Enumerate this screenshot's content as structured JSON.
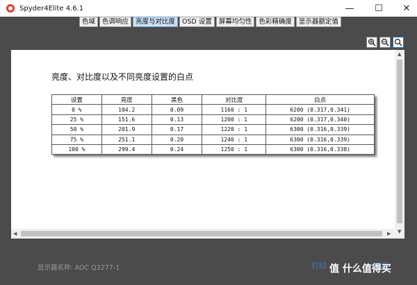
{
  "window": {
    "title": "Spyder4Elite 4.6.1",
    "controls": [
      "—",
      "☐",
      "✕"
    ]
  },
  "tabs": [
    {
      "label": "色域",
      "active": false
    },
    {
      "label": "色调响应",
      "active": false
    },
    {
      "label": "亮度与对比度",
      "active": true
    },
    {
      "label": "OSD 设置",
      "active": false
    },
    {
      "label": "屏幕均匀性",
      "active": false
    },
    {
      "label": "色彩精确度",
      "active": false
    },
    {
      "label": "显示器额定值",
      "active": false
    }
  ],
  "toolbar": {
    "icons": [
      "zoom-in-icon",
      "zoom-out-icon",
      "zoom-fit-icon"
    ]
  },
  "report": {
    "title": "亮度、对比度以及不同亮度设置的白点",
    "headers": [
      "设置",
      "亮度",
      "黑色",
      "对比度",
      "白点"
    ],
    "rows": [
      [
        "0 %",
        "104.2",
        "0.09",
        "1160 : 1",
        "6200 (0.317,0.341)"
      ],
      [
        "25 %",
        "151.6",
        "0.13",
        "1200 : 1",
        "6200 (0.317,0.340)"
      ],
      [
        "50 %",
        "201.9",
        "0.17",
        "1220 : 1",
        "6300 (0.316,0.339)"
      ],
      [
        "75 %",
        "251.1",
        "0.20",
        "1240 : 1",
        "6300 (0.316,0.339)"
      ],
      [
        "100 %",
        "299.4",
        "0.24",
        "1250 : 1",
        "6300 (0.316,0.338)"
      ]
    ]
  },
  "footer": {
    "display_name": "显示器名称: AOC Q3277-1",
    "print_label": "打印",
    "close_label": "关闭",
    "watermark": "值 什么值得买"
  },
  "colors": {
    "background": "#4b4b4b",
    "active_tab": "#cfe3f7",
    "accent": "#3a7bd5"
  }
}
